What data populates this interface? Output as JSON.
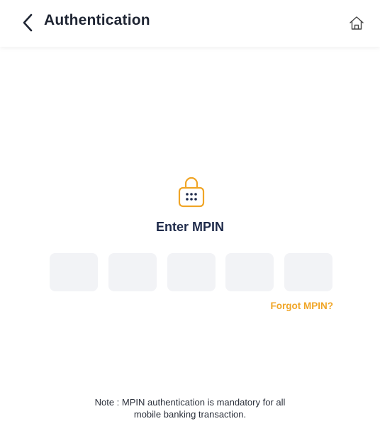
{
  "header": {
    "title": "Authentication",
    "back_icon": "chevron-left-icon",
    "home_icon": "home-icon"
  },
  "mpin": {
    "prompt": "Enter MPIN",
    "lock_icon": "lock-keypad-icon",
    "boxes": [
      "",
      "",
      "",
      "",
      ""
    ],
    "forgot_label": "Forgot MPIN?"
  },
  "note": {
    "line1": "Note : MPIN authentication is mandatory for all",
    "line2": "mobile banking transaction."
  },
  "colors": {
    "accent": "#f0a526",
    "heading": "#1e2a4a",
    "pin_box_bg": "#f2f3f6"
  }
}
